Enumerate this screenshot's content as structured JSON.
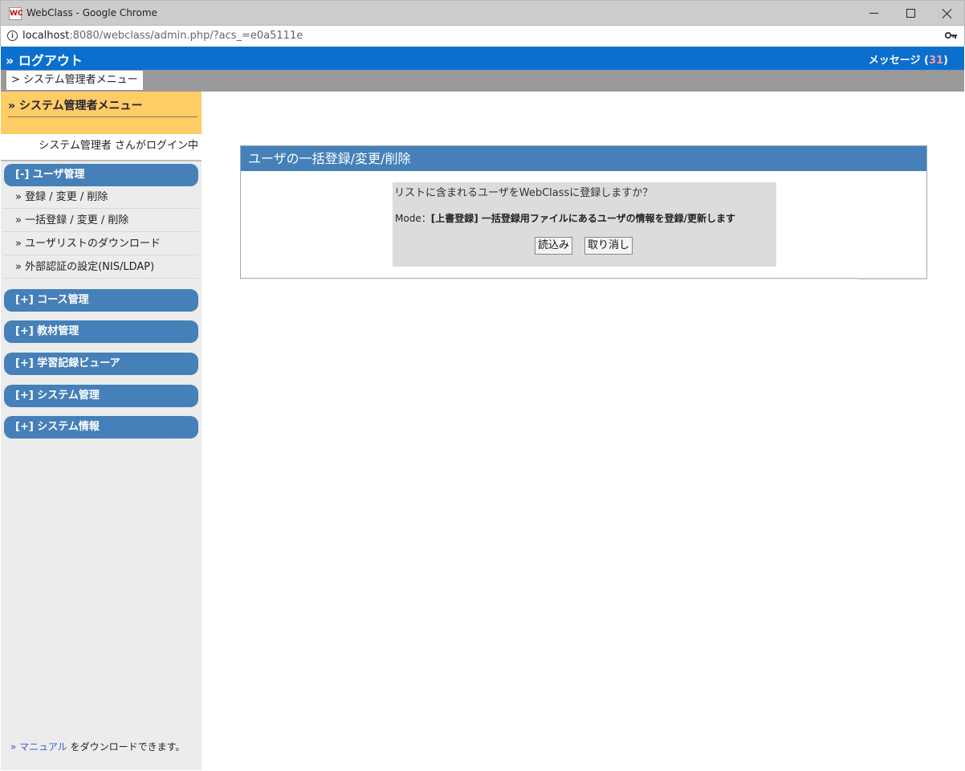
{
  "window": {
    "title": "WebClass - Google Chrome",
    "app_icon_text": "WC"
  },
  "address": {
    "host": "localhost",
    "rest": ":8080/webclass/admin.php/?acs_=e0a5111e"
  },
  "header": {
    "logout": "» ログアウト",
    "messages_label": "メッセージ (",
    "messages_count": "31",
    "messages_close": ")"
  },
  "breadcrumb": {
    "item": "> システム管理者メニュー"
  },
  "sidebar": {
    "title": "» システム管理者メニュー",
    "login_status": "システム管理者 さんがログイン中",
    "groups": [
      {
        "label": "[-] ユーザ管理"
      },
      {
        "label": "[+] コース管理"
      },
      {
        "label": "[+] 教材管理"
      },
      {
        "label": "[+] 学習記録ビューア"
      },
      {
        "label": "[+] システム管理"
      },
      {
        "label": "[+] システム情報"
      }
    ],
    "user_items": [
      {
        "label": "» 登録 / 変更 / 削除"
      },
      {
        "label": "» 一括登録 / 変更 / 削除"
      },
      {
        "label": "» ユーザリストのダウンロード"
      },
      {
        "label": "» 外部認証の設定(NIS/LDAP)"
      }
    ],
    "footer": {
      "link": "» マニュアル",
      "text": " をダウンロードできます。"
    }
  },
  "main": {
    "panel_title": "ユーザの一括登録/変更/削除",
    "question": "リストに含まれるユーザをWebClassに登録しますか？",
    "mode_prefix": "Mode：",
    "mode_detail": "[上書登録] 一括登録用ファイルにあるユーザの情報を登録/更新します",
    "load_button": "読込み",
    "cancel_button": "取り消し"
  }
}
